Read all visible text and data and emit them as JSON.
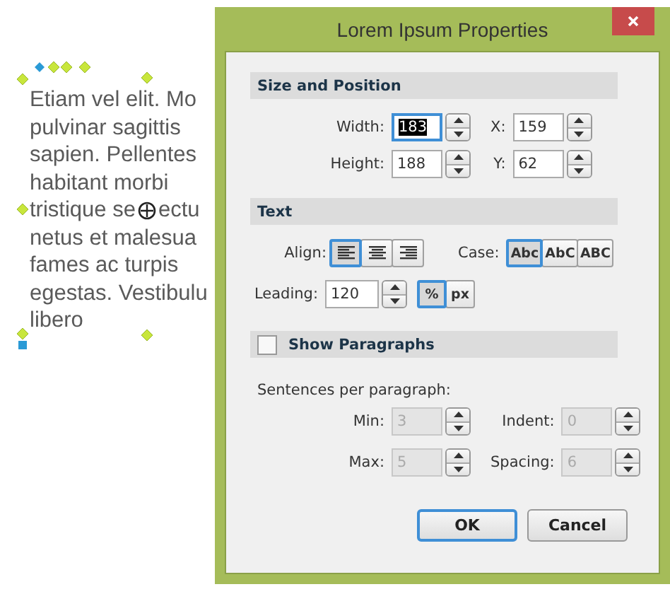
{
  "canvas": {
    "lines": [
      {
        "text": "Etiam vel elit. Mo"
      },
      {
        "text": "pulvinar sagittis"
      },
      {
        "text": "sapien. Pellentes"
      },
      {
        "text": "habitant morbi"
      },
      {
        "text": "tristique se",
        "after_cursor": "ectu"
      },
      {
        "text": "netus et malesua"
      },
      {
        "text": "fames ac turpis"
      },
      {
        "text": "egestas. Vestibulu"
      },
      {
        "text": "libero"
      }
    ]
  },
  "dialog": {
    "title": "Lorem Ipsum Properties",
    "size_position": {
      "title": "Size and Position",
      "fields": [
        {
          "label": "Width:",
          "value": "183",
          "focused": true
        },
        {
          "label": "X:",
          "value": "159",
          "focused": false
        },
        {
          "label": "Height:",
          "value": "188",
          "focused": false
        },
        {
          "label": "Y:",
          "value": "62",
          "focused": false
        }
      ]
    },
    "text": {
      "title": "Text",
      "align_label": "Align:",
      "align": [
        {
          "kind": "left",
          "selected": true
        },
        {
          "kind": "center",
          "selected": false
        },
        {
          "kind": "right",
          "selected": false
        }
      ],
      "case_label": "Case:",
      "case": [
        {
          "label": "Abc",
          "selected": true
        },
        {
          "label": "AbC",
          "selected": false
        },
        {
          "label": "ABC",
          "selected": false
        }
      ],
      "leading": {
        "label": "Leading:",
        "value": "120"
      },
      "units": [
        {
          "label": "%",
          "selected": true
        },
        {
          "label": "px",
          "selected": false
        }
      ]
    },
    "paragraphs": {
      "label": "Show Paragraphs",
      "checked": false,
      "caption": "Sentences per paragraph:",
      "fields": [
        {
          "label": "Min:",
          "value": "3",
          "disabled": true
        },
        {
          "label": "Indent:",
          "value": "0",
          "disabled": true
        },
        {
          "label": "Max:",
          "value": "5",
          "disabled": true
        },
        {
          "label": "Spacing:",
          "value": "6",
          "disabled": true
        }
      ]
    },
    "buttons": [
      {
        "label": "OK",
        "default": true
      },
      {
        "label": "Cancel",
        "default": false
      }
    ]
  }
}
